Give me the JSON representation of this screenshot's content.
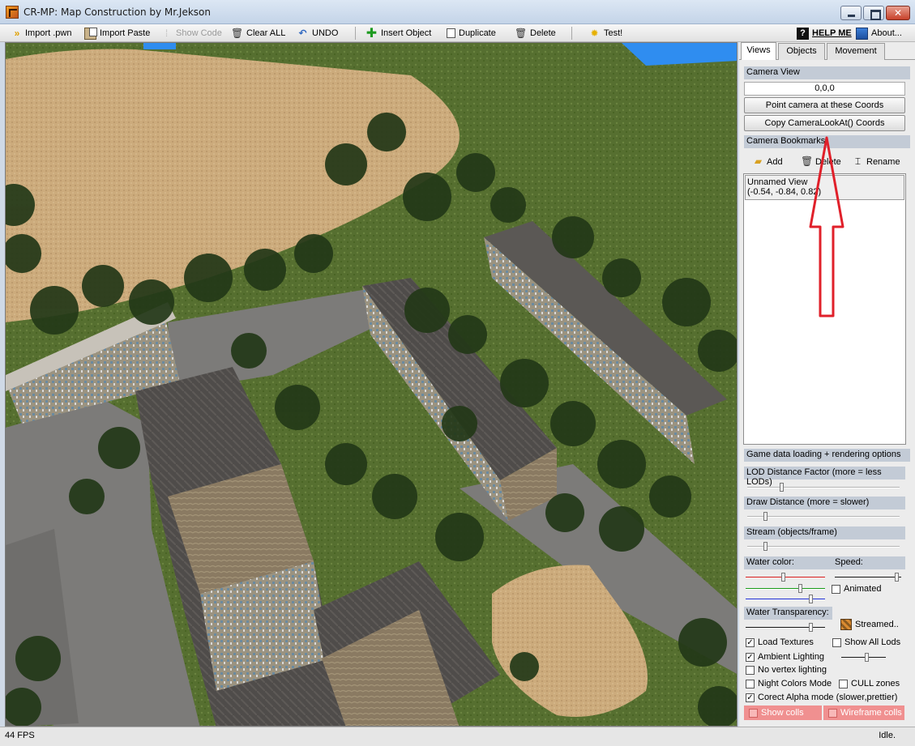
{
  "window": {
    "title": "CR-MP: Map Construction by Mr.Jekson"
  },
  "toolbar": {
    "import_pwn": "Import .pwn",
    "import_paste": "Import Paste",
    "show_code": "Show Code",
    "clear_all": "Clear ALL",
    "undo": "UNDO",
    "insert_object": "Insert Object",
    "duplicate": "Duplicate",
    "delete": "Delete",
    "test": "Test!",
    "help_me": "HELP ME",
    "about": "About..."
  },
  "panel": {
    "tabs": [
      "Views",
      "Objects",
      "Movement"
    ],
    "camera_view": {
      "header": "Camera View",
      "coords_value": "0,0,0",
      "point_camera_button": "Point camera at these Coords",
      "copy_lookat_button": "Copy CameraLookAt() Coords"
    },
    "bookmarks": {
      "header": "Camera Bookmarks",
      "add": "Add",
      "delete": "Delete",
      "rename": "Rename",
      "items": [
        {
          "name": "Unnamed View",
          "coords": "(-0.54, -0.84, 0.82)"
        }
      ]
    },
    "rendering": {
      "header": "Game data loading + rendering options",
      "lod_label": "LOD Distance Factor (more = less LODs)",
      "draw_distance_label": "Draw Distance (more = slower)",
      "stream_label": "Stream (objects/frame)",
      "water_color_label": "Water color:",
      "speed_label": "Speed:",
      "animated_label": "Animated",
      "water_transparency_label": "Water Transparency:",
      "streamed_label": "Streamed..",
      "load_textures": "Load Textures",
      "show_all_lods": "Show All Lods",
      "ambient_lighting": "Ambient Lighting",
      "no_vertex_lighting": "No vertex lighting",
      "night_colors_mode": "Night Colors Mode",
      "cull_zones": "CULL zones",
      "correct_alpha_mode": "Corect Alpha mode (slower,prettier)",
      "show_colls": "Show colls",
      "wireframe_colls": "Wireframe colls",
      "checked": {
        "load_textures": true,
        "show_all_lods": false,
        "ambient_lighting": true,
        "no_vertex_lighting": false,
        "night_colors_mode": false,
        "cull_zones": false,
        "correct_alpha_mode": true,
        "show_colls": false,
        "wireframe_colls": false,
        "animated": false
      },
      "slider_levels": {
        "lod": 0.22,
        "draw_distance": 0.11,
        "stream": 0.11,
        "water_red": 0.48,
        "water_green": 0.71,
        "water_blue": 0.85,
        "speed": 0.98,
        "water_transparency": 0.85,
        "ambient": 0.6
      }
    }
  },
  "status": {
    "fps": "44 FPS",
    "state": "Idle."
  },
  "colors": {
    "annotation_arrow": "#e0202a",
    "grass": "#4d6a2a",
    "sand": "#c9a978",
    "road": "#7f7f7f"
  }
}
